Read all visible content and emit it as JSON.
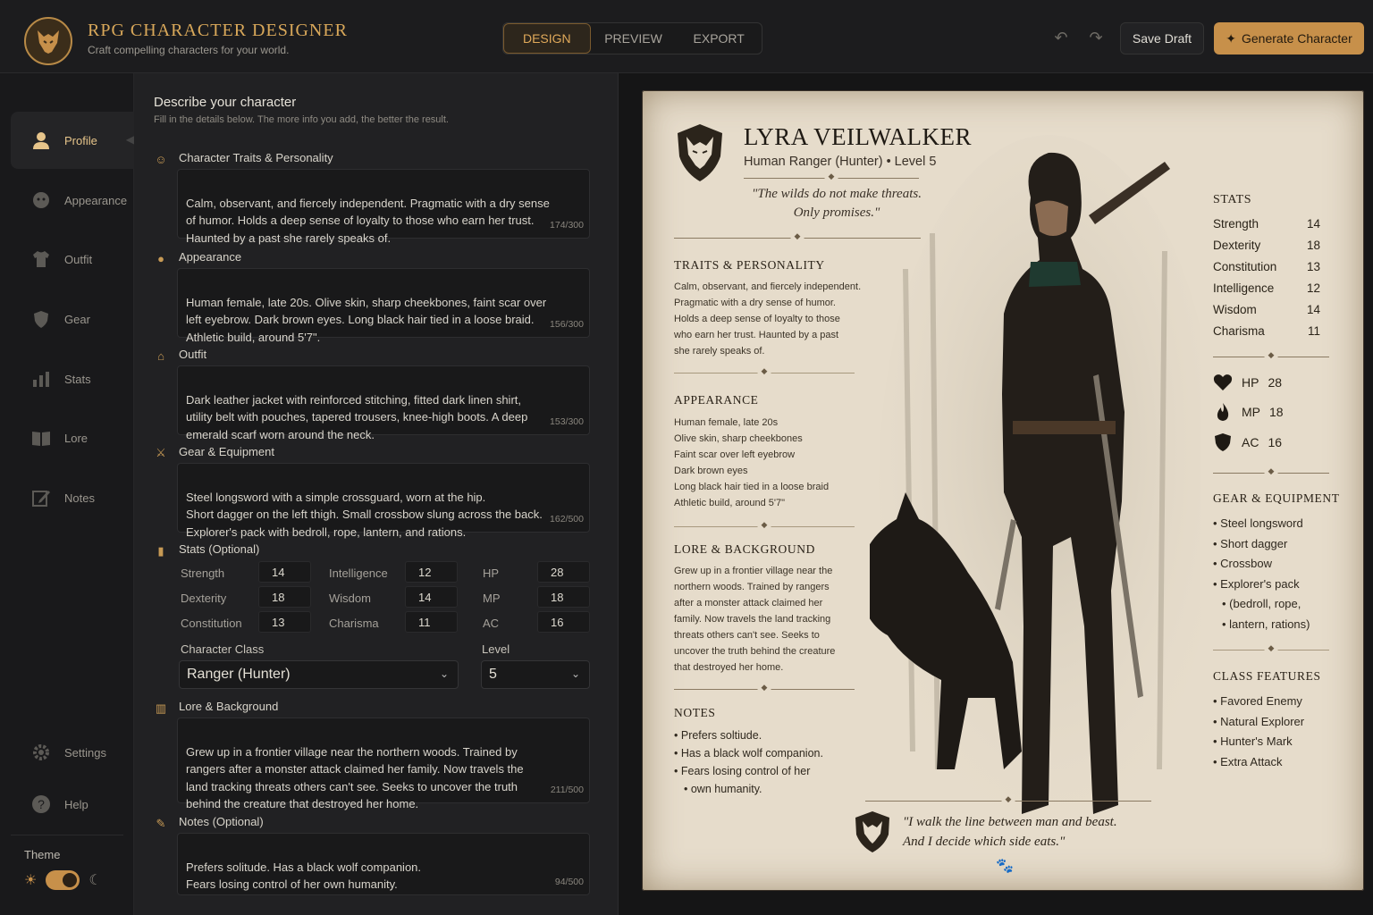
{
  "app": {
    "title": "RPG CHARACTER DESIGNER",
    "subtitle": "Craft compelling characters for your world."
  },
  "tabs": [
    "DESIGN",
    "PREVIEW",
    "EXPORT"
  ],
  "actions": {
    "save": "Save Draft",
    "generate": "Generate Character"
  },
  "colors": {
    "accent": "#c7904a",
    "background": "#17171a",
    "parchment": "#e6dccb"
  },
  "sidebar": {
    "items": [
      {
        "label": "Profile",
        "icon": "user-icon"
      },
      {
        "label": "Appearance",
        "icon": "face-icon"
      },
      {
        "label": "Outfit",
        "icon": "shirt-icon"
      },
      {
        "label": "Gear",
        "icon": "shield-icon"
      },
      {
        "label": "Stats",
        "icon": "bar-chart-icon"
      },
      {
        "label": "Lore",
        "icon": "book-icon"
      },
      {
        "label": "Notes",
        "icon": "edit-icon"
      }
    ],
    "settings": "Settings",
    "help": "Help",
    "theme": "Theme"
  },
  "form": {
    "title": "Describe your character",
    "subtitle": "Fill in the details below. The more info you add, the better the result.",
    "traits": {
      "label": "Character Traits & Personality",
      "value": "Calm, observant, and fiercely independent. Pragmatic with a dry sense\nof humor. Holds a deep sense of loyalty to those who earn her trust.\nHaunted by a past she rarely speaks of.",
      "count": "174/300"
    },
    "appearance": {
      "label": "Appearance",
      "value": "Human female, late 20s. Olive skin, sharp cheekbones, faint scar over\nleft eyebrow. Dark brown eyes. Long black hair tied in a loose braid.\nAthletic build, around 5'7\".",
      "count": "156/300"
    },
    "outfit": {
      "label": "Outfit",
      "value": "Dark leather jacket with reinforced stitching, fitted dark linen shirt,\nutility belt with pouches, tapered trousers, knee-high boots. A deep\nemerald scarf worn around the neck.",
      "count": "153/300"
    },
    "gear": {
      "label": "Gear & Equipment",
      "value": "Steel longsword with a simple crossguard, worn at the hip.\nShort dagger on the left thigh. Small crossbow slung across the back.\nExplorer's pack with bedroll, rope, lantern, and rations.",
      "count": "162/500"
    },
    "stats": {
      "label": "Stats (Optional)",
      "items": [
        {
          "name": "Strength",
          "value": "14"
        },
        {
          "name": "Intelligence",
          "value": "12"
        },
        {
          "name": "HP",
          "value": "28"
        },
        {
          "name": "Dexterity",
          "value": "18"
        },
        {
          "name": "Wisdom",
          "value": "14"
        },
        {
          "name": "MP",
          "value": "18"
        },
        {
          "name": "Constitution",
          "value": "13"
        },
        {
          "name": "Charisma",
          "value": "11"
        },
        {
          "name": "AC",
          "value": "16"
        }
      ]
    },
    "class": {
      "label": "Character Class",
      "value": "Ranger (Hunter)"
    },
    "level": {
      "label": "Level",
      "value": "5"
    },
    "lore": {
      "label": "Lore & Background",
      "value": "Grew up in a frontier village near the northern woods. Trained by\nrangers after a monster attack claimed her family. Now travels the\nland tracking threats others can't see. Seeks to uncover the truth\nbehind the creature that destroyed her home.",
      "count": "211/500"
    },
    "notes": {
      "label": "Notes (Optional)",
      "value": "Prefers solitude. Has a black wolf companion.\nFears losing control of her own humanity.",
      "count": "94/500"
    }
  },
  "sheet": {
    "name": "LYRA VEILWALKER",
    "class_line": "Human Ranger (Hunter) • Level 5",
    "quote": "\"The wilds do not make threats.\nOnly promises.\"",
    "traits": {
      "title": "TRAITS & PERSONALITY",
      "text": "Calm, observant, and fiercely independent.\nPragmatic with a dry sense of humor.\nHolds a deep sense of loyalty to those\nwho earn her trust. Haunted by a past\nshe rarely speaks of."
    },
    "appearance": {
      "title": "APPEARANCE",
      "text": "Human female, late 20s\nOlive skin, sharp cheekbones\nFaint scar over left eyebrow\nDark brown eyes\nLong black hair tied in a loose braid\nAthletic build, around 5'7\""
    },
    "lore": {
      "title": "LORE & BACKGROUND",
      "text": "Grew up in a frontier village near the\nnorthern woods. Trained by rangers\nafter a monster attack claimed her\nfamily. Now travels the land tracking\nthreats others can't see. Seeks to\nuncover the truth behind the creature\nthat destroyed her home."
    },
    "notes": {
      "title": "NOTES",
      "items": [
        "Prefers soltiude.",
        "Has a black wolf companion.",
        "Fears losing control of her",
        "own humanity."
      ]
    },
    "stats": {
      "title": "STATS",
      "items": [
        {
          "name": "Strength",
          "value": "14"
        },
        {
          "name": "Dexterity",
          "value": "18"
        },
        {
          "name": "Constitution",
          "value": "13"
        },
        {
          "name": "Intelligence",
          "value": "12"
        },
        {
          "name": "Wisdom",
          "value": "14"
        },
        {
          "name": "Charisma",
          "value": "11"
        }
      ]
    },
    "vitals": [
      {
        "name": "HP",
        "value": "28",
        "icon": "heart-icon"
      },
      {
        "name": "MP",
        "value": "18",
        "icon": "flame-icon"
      },
      {
        "name": "AC",
        "value": "16",
        "icon": "shield-icon"
      }
    ],
    "gear": {
      "title": "GEAR & EQUIPMENT",
      "items": [
        "Steel longsword",
        "Short dagger",
        "Crossbow",
        "Explorer's pack",
        "(bedroll, rope,",
        "lantern, rations)"
      ]
    },
    "features": {
      "title": "CLASS FEATURES",
      "items": [
        "Favored Enemy",
        "Natural Explorer",
        "Hunter's Mark",
        "Extra Attack"
      ]
    },
    "bottom_quote": "\"I walk the line between man and beast.\nAnd I decide which side eats.\""
  }
}
